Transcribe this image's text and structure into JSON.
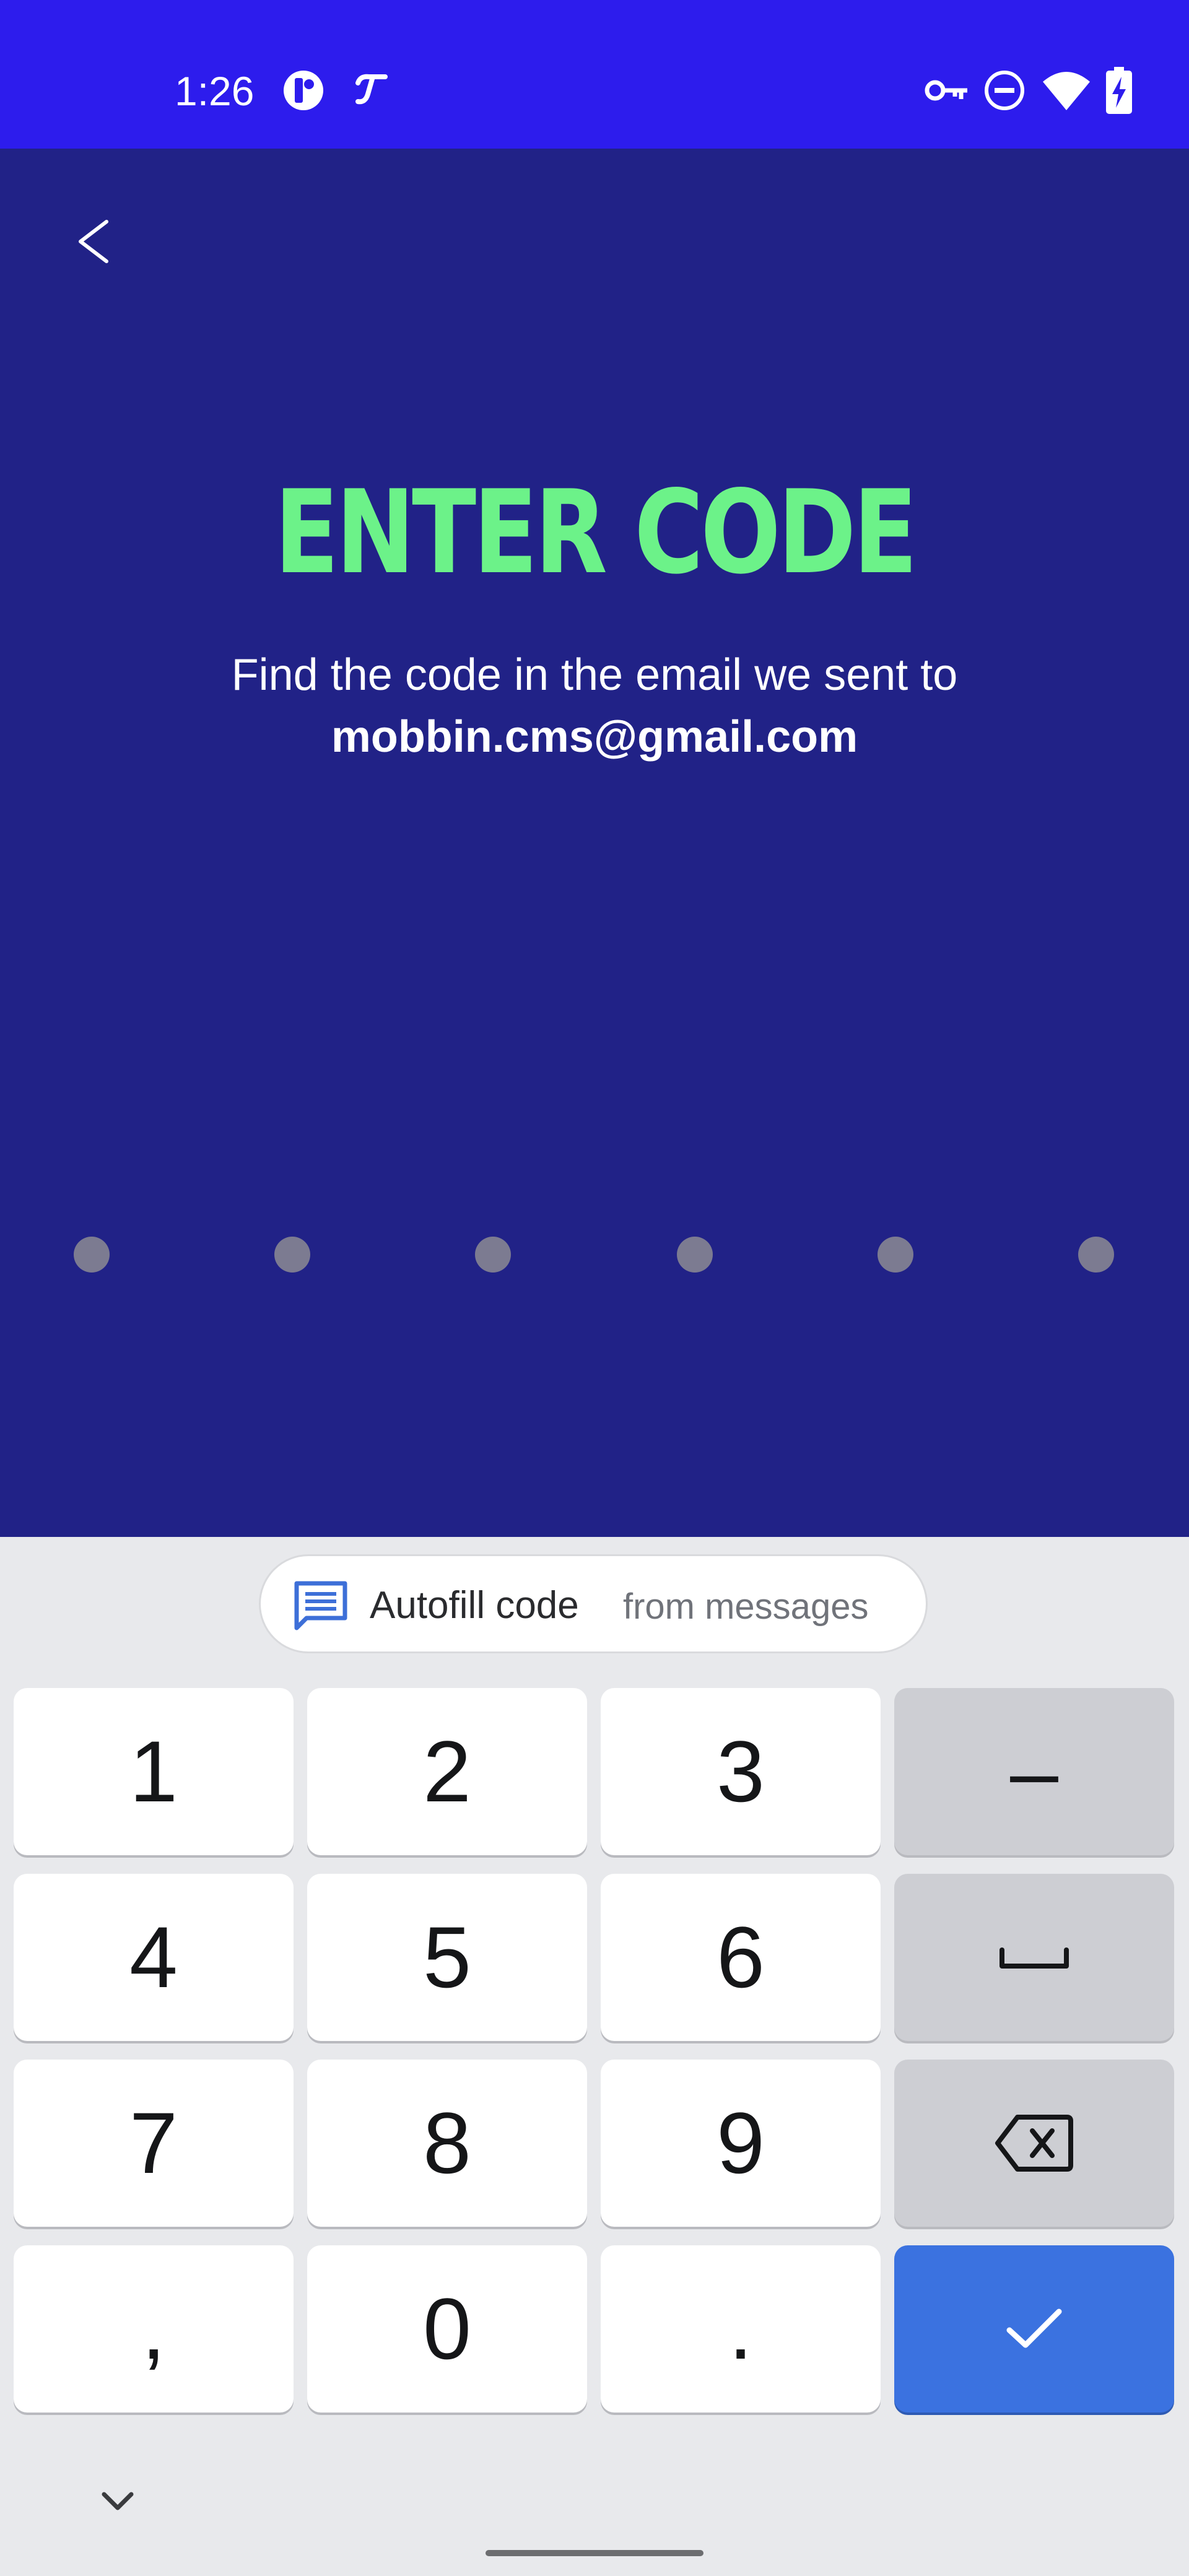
{
  "status_bar": {
    "time": "1:26",
    "left_icons": [
      "app-circle-icon",
      "tinder-flame-icon"
    ],
    "right_icons": [
      "vpn-key-icon",
      "do-not-disturb-icon",
      "wifi-icon",
      "battery-charging-icon"
    ],
    "background_color": "#2d1ced"
  },
  "header": {
    "back_icon": "chevron-left-icon"
  },
  "main": {
    "title": "ENTER CODE",
    "subtitle": "Find the code in the email we sent to",
    "email": "mobbin.cms@gmail.com",
    "code_length": 6,
    "entered_digits": 0,
    "colors": {
      "background": "#212287",
      "title": "#6cf289",
      "dot": "#7c7b91"
    }
  },
  "keyboard": {
    "autofill": {
      "label": "Autofill code",
      "sublabel": "from messages",
      "icon": "message-icon"
    },
    "keys": {
      "k1": "1",
      "k2": "2",
      "k3": "3",
      "k4": "4",
      "k5": "5",
      "k6": "6",
      "k7": "7",
      "k8": "8",
      "k9": "9",
      "comma": ",",
      "k0": "0",
      "period": ".",
      "minus": "–"
    },
    "function_keys": [
      "space-icon",
      "backspace-icon",
      "checkmark-icon"
    ],
    "hide_icon": "chevron-down-icon",
    "colors": {
      "enter_key": "#3b72e0",
      "function_key": "#cdced3",
      "key": "#ffffff"
    }
  }
}
